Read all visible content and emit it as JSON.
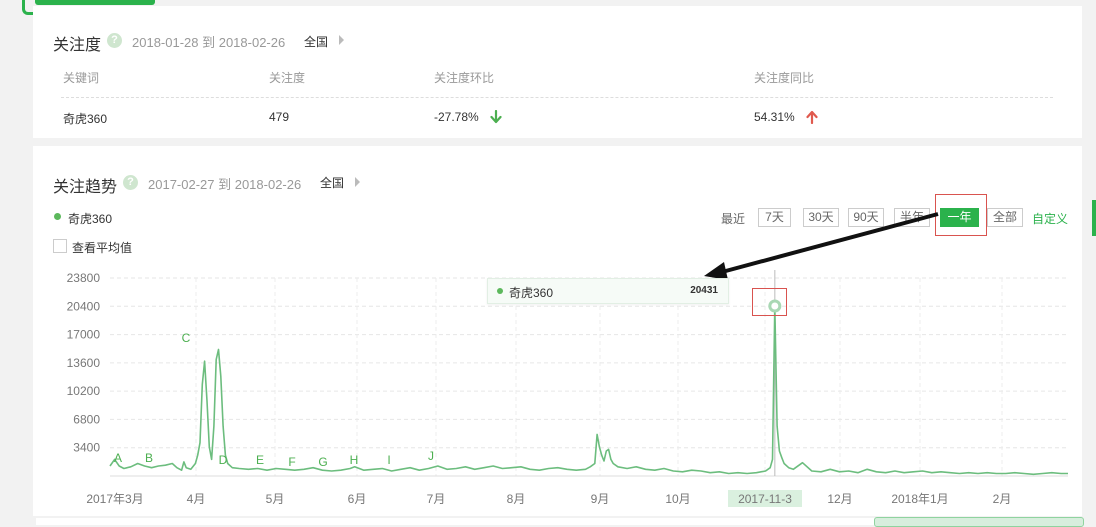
{
  "attention": {
    "title": "关注度",
    "range": "2018-01-28 到 2018-02-26",
    "region": "全国",
    "headers": [
      "关键词",
      "关注度",
      "关注度环比",
      "关注度同比"
    ],
    "row": {
      "keyword": "奇虎360",
      "value": "479",
      "mom": "-27.78%",
      "yoy": "54.31%"
    },
    "colors": {
      "down": "#4caf50",
      "up": "#e05a4f"
    }
  },
  "trend": {
    "title": "关注趋势",
    "range": "2017-02-27 到 2018-02-26",
    "region": "全国",
    "legend": "奇虎360",
    "avg_label": "查看平均值",
    "recent_label": "最近",
    "ranges": [
      "7天",
      "30天",
      "90天",
      "半年",
      "一年",
      "全部"
    ],
    "active_range": "一年",
    "custom_label": "自定义",
    "tooltip": {
      "name": "奇虎360",
      "value": "20431"
    },
    "highlight_date": "2017-11-3"
  },
  "chart_data": {
    "type": "line",
    "series_name": "奇虎360",
    "yticks": [
      3400,
      6800,
      10200,
      13600,
      17000,
      20400,
      23800
    ],
    "ylim": [
      0,
      23800
    ],
    "xlabels": [
      "2017年3月",
      "4月",
      "5月",
      "6月",
      "7月",
      "8月",
      "9月",
      "10月",
      "2017-11-3",
      "12月",
      "2018年1月",
      "2月"
    ],
    "annotations": [
      "A",
      "B",
      "C",
      "D",
      "E",
      "F",
      "G",
      "H",
      "I",
      "J"
    ],
    "points": [
      [
        0,
        1200
      ],
      [
        2,
        2000
      ],
      [
        4,
        1200
      ],
      [
        6,
        900
      ],
      [
        9,
        1100
      ],
      [
        12,
        1500
      ],
      [
        15,
        1200
      ],
      [
        18,
        1000
      ],
      [
        21,
        1200
      ],
      [
        24,
        1300
      ],
      [
        27,
        1500
      ],
      [
        29,
        1000
      ],
      [
        31,
        700
      ],
      [
        32,
        1700
      ],
      [
        33,
        1000
      ],
      [
        35,
        800
      ],
      [
        37,
        1500
      ],
      [
        38,
        2500
      ],
      [
        39,
        4000
      ],
      [
        40,
        11000
      ],
      [
        41,
        13800
      ],
      [
        42,
        9000
      ],
      [
        43,
        3500
      ],
      [
        44,
        2000
      ],
      [
        45,
        6000
      ],
      [
        46,
        14000
      ],
      [
        47,
        15200
      ],
      [
        48,
        12000
      ],
      [
        49,
        6000
      ],
      [
        50,
        2500
      ],
      [
        51,
        1500
      ],
      [
        53,
        1000
      ],
      [
        56,
        900
      ],
      [
        60,
        800
      ],
      [
        64,
        900
      ],
      [
        68,
        700
      ],
      [
        72,
        900
      ],
      [
        76,
        800
      ],
      [
        80,
        700
      ],
      [
        84,
        800
      ],
      [
        88,
        1000
      ],
      [
        92,
        700
      ],
      [
        96,
        600
      ],
      [
        100,
        700
      ],
      [
        104,
        900
      ],
      [
        106,
        1100
      ],
      [
        110,
        700
      ],
      [
        114,
        800
      ],
      [
        118,
        900
      ],
      [
        122,
        600
      ],
      [
        126,
        800
      ],
      [
        130,
        1000
      ],
      [
        134,
        700
      ],
      [
        138,
        900
      ],
      [
        142,
        1200
      ],
      [
        146,
        800
      ],
      [
        150,
        900
      ],
      [
        154,
        1100
      ],
      [
        158,
        800
      ],
      [
        162,
        1000
      ],
      [
        166,
        1200
      ],
      [
        170,
        900
      ],
      [
        174,
        1000
      ],
      [
        178,
        1100
      ],
      [
        182,
        800
      ],
      [
        186,
        700
      ],
      [
        190,
        900
      ],
      [
        194,
        1000
      ],
      [
        198,
        800
      ],
      [
        202,
        700
      ],
      [
        206,
        800
      ],
      [
        208,
        1100
      ],
      [
        210,
        1500
      ],
      [
        211,
        5000
      ],
      [
        212,
        3500
      ],
      [
        213,
        2500
      ],
      [
        214,
        1800
      ],
      [
        215,
        3000
      ],
      [
        216,
        3200
      ],
      [
        217,
        2000
      ],
      [
        218,
        1500
      ],
      [
        220,
        1100
      ],
      [
        224,
        900
      ],
      [
        228,
        1100
      ],
      [
        232,
        800
      ],
      [
        236,
        700
      ],
      [
        240,
        900
      ],
      [
        244,
        600
      ],
      [
        248,
        500
      ],
      [
        252,
        700
      ],
      [
        256,
        600
      ],
      [
        260,
        400
      ],
      [
        264,
        500
      ],
      [
        268,
        300
      ],
      [
        272,
        400
      ],
      [
        276,
        300
      ],
      [
        280,
        400
      ],
      [
        284,
        600
      ],
      [
        286,
        1000
      ],
      [
        287,
        2000
      ],
      [
        288,
        20431
      ],
      [
        289,
        6000
      ],
      [
        290,
        3000
      ],
      [
        291,
        2200
      ],
      [
        292,
        1500
      ],
      [
        294,
        1000
      ],
      [
        296,
        800
      ],
      [
        300,
        1600
      ],
      [
        304,
        600
      ],
      [
        308,
        500
      ],
      [
        312,
        800
      ],
      [
        316,
        500
      ],
      [
        320,
        600
      ],
      [
        324,
        400
      ],
      [
        328,
        800
      ],
      [
        332,
        500
      ],
      [
        336,
        400
      ],
      [
        340,
        600
      ],
      [
        344,
        400
      ],
      [
        348,
        500
      ],
      [
        352,
        600
      ],
      [
        356,
        400
      ],
      [
        360,
        500
      ],
      [
        364,
        400
      ],
      [
        368,
        300
      ],
      [
        372,
        400
      ],
      [
        376,
        300
      ],
      [
        380,
        400
      ],
      [
        384,
        300
      ],
      [
        388,
        300
      ],
      [
        392,
        400
      ],
      [
        396,
        300
      ],
      [
        400,
        200
      ],
      [
        404,
        300
      ],
      [
        408,
        400
      ],
      [
        412,
        300
      ],
      [
        415,
        300
      ]
    ]
  }
}
